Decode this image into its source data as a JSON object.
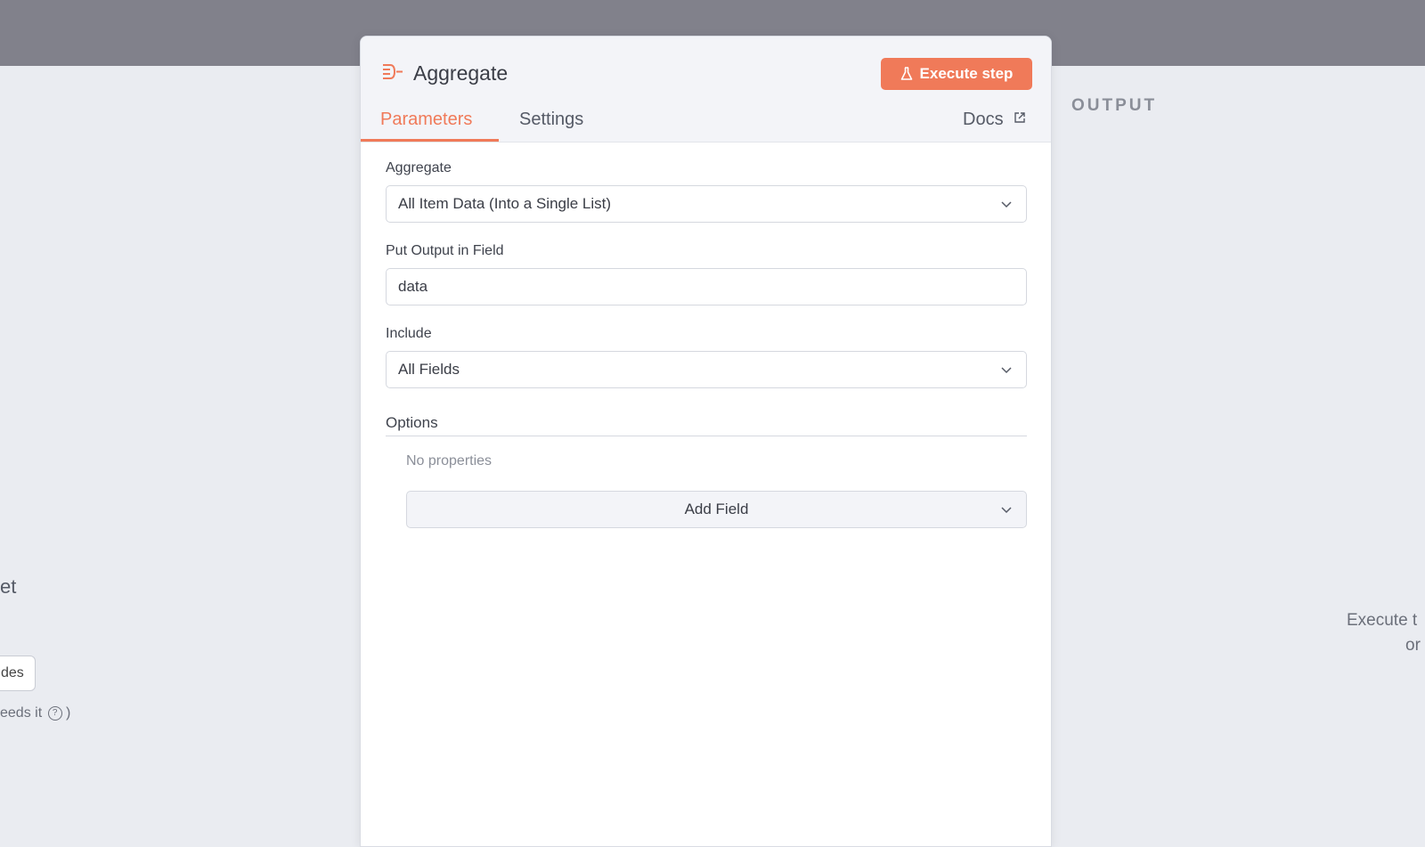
{
  "background": {
    "left_title": "et",
    "left_button_label": "des",
    "left_hint": "eeds it",
    "left_hint_paren": ")",
    "output_label": "OUTPUT",
    "right_hint_line1": "Execute t",
    "right_hint_line2": "or"
  },
  "panel": {
    "title": "Aggregate",
    "execute_label": "Execute step",
    "accent_color": "#f07a59",
    "tabs": [
      {
        "label": "Parameters",
        "active": true
      },
      {
        "label": "Settings",
        "active": false
      }
    ],
    "docs_label": "Docs"
  },
  "form": {
    "aggregate": {
      "label": "Aggregate",
      "value": "All Item Data (Into a Single List)"
    },
    "output_field": {
      "label": "Put Output in Field",
      "value": "data"
    },
    "include": {
      "label": "Include",
      "value": "All Fields"
    },
    "options": {
      "label": "Options",
      "empty_text": "No properties",
      "add_label": "Add Field"
    }
  },
  "icons": [
    "aggregate-node-icon",
    "flask-icon",
    "external-link-icon",
    "chevron-down-icon",
    "help-circle-icon"
  ]
}
